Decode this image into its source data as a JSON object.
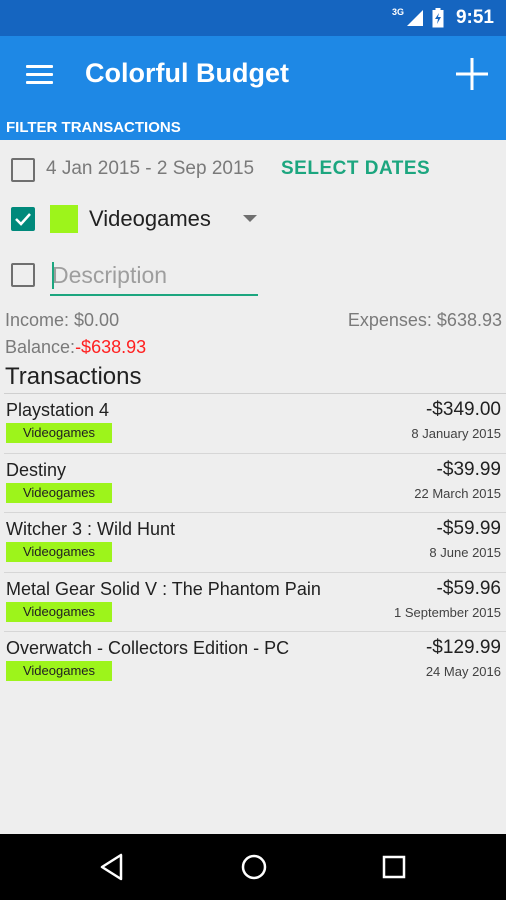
{
  "status_bar": {
    "network": "3G",
    "time": "9:51",
    "icons": [
      "signal-icon",
      "battery-charging-icon"
    ]
  },
  "app_bar": {
    "title": "Colorful Budget",
    "menu_icon": "menu-icon",
    "add_icon": "add-icon"
  },
  "filter": {
    "header": "FILTER TRANSACTIONS",
    "date_range": "4 Jan 2015 - 2 Sep 2015",
    "select_dates_label": "SELECT DATES",
    "date_checked": false,
    "category_checked": true,
    "category_label": "Videogames",
    "category_color": "#9df41b",
    "description_checked": false,
    "description_placeholder": "Description"
  },
  "summary": {
    "income": "Income: $0.00",
    "expenses": "Expenses: $638.93",
    "balance_label": "Balance:",
    "balance_value": "-$638.93"
  },
  "transactions_title": "Transactions",
  "transactions": [
    {
      "name": "Playstation 4",
      "amount": "-$349.00",
      "category": "Videogames",
      "date": "8 January 2015"
    },
    {
      "name": "Destiny",
      "amount": "-$39.99",
      "category": "Videogames",
      "date": "22 March 2015"
    },
    {
      "name": "Witcher 3 : Wild Hunt",
      "amount": "-$59.99",
      "category": "Videogames",
      "date": "8 June 2015"
    },
    {
      "name": "Metal Gear Solid V : The Phantom Pain",
      "amount": "-$59.96",
      "category": "Videogames",
      "date": "1 September 2015"
    },
    {
      "name": "Overwatch - Collectors Edition - PC",
      "amount": "-$129.99",
      "category": "Videogames",
      "date": "24 May 2016"
    }
  ],
  "nav_bar": {
    "icons": [
      "back-icon",
      "home-icon",
      "recents-icon"
    ]
  },
  "colors": {
    "status_bar": "#1565c0",
    "app_bar": "#1e88e5",
    "accent": "#1ca67f",
    "checkbox": "#00897b",
    "negative": "#ff1f1f",
    "category_tag": "#9df41b"
  }
}
